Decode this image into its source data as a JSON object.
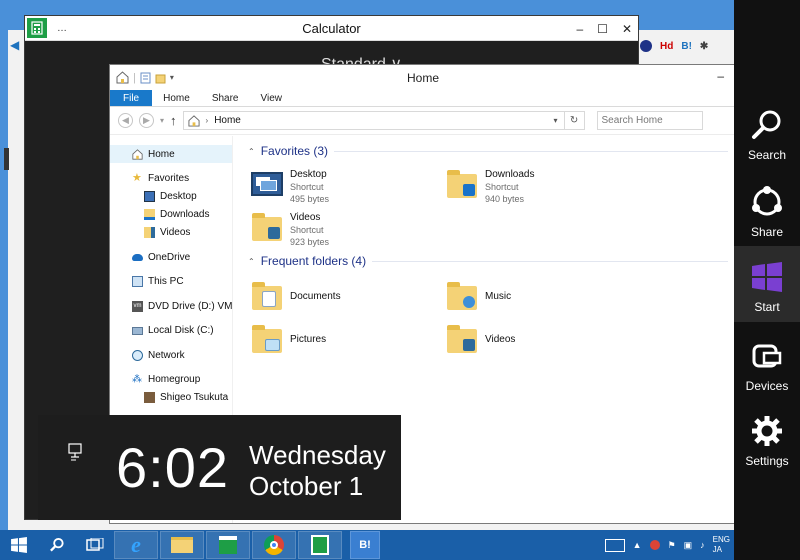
{
  "calculator": {
    "title": "Calculator",
    "mode": "Standard ∨",
    "title_dots": "…"
  },
  "explorer": {
    "title": "Home",
    "ribbon_tabs": [
      "File",
      "Home",
      "Share",
      "View"
    ],
    "address": "Home",
    "search_placeholder": "Search Home",
    "sidebar": {
      "home": "Home",
      "favorites": "Favorites",
      "desktop": "Desktop",
      "downloads": "Downloads",
      "videos": "Videos",
      "onedrive": "OneDrive",
      "this_pc": "This PC",
      "dvd": "DVD Drive (D:) VMware",
      "local_disk": "Local Disk (C:)",
      "network": "Network",
      "homegroup": "Homegroup",
      "user": "Shigeo Tsukuta"
    },
    "favorites_header": "Favorites (3)",
    "favorites": [
      {
        "name": "Desktop",
        "type": "Shortcut",
        "size": "495 bytes"
      },
      {
        "name": "Downloads",
        "type": "Shortcut",
        "size": "940 bytes"
      },
      {
        "name": "Videos",
        "type": "Shortcut",
        "size": "923 bytes"
      }
    ],
    "frequent_header": "Frequent folders (4)",
    "frequent": [
      {
        "name": "Documents"
      },
      {
        "name": "Music"
      },
      {
        "name": "Pictures"
      },
      {
        "name": "Videos"
      }
    ]
  },
  "clock": {
    "time": "6:02",
    "day": "Wednesday",
    "date": "October 1"
  },
  "charms": [
    {
      "label": "Search",
      "icon": "search-icon"
    },
    {
      "label": "Share",
      "icon": "share-icon"
    },
    {
      "label": "Start",
      "icon": "windows-logo-icon"
    },
    {
      "label": "Devices",
      "icon": "devices-icon"
    },
    {
      "label": "Settings",
      "icon": "gear-icon"
    }
  ],
  "taskbar": {
    "bookmark_app_label": "B!",
    "lang_top": "ENG",
    "lang_bottom": "JA"
  },
  "background_browser": {
    "toolbar_text": "Hd",
    "bookmark_text": "B!"
  },
  "colors": {
    "accent_blue": "#1979ca",
    "charms_bg": "#111111",
    "taskbar": "#1a5fa8",
    "start_tile": "#7a3fd1"
  }
}
